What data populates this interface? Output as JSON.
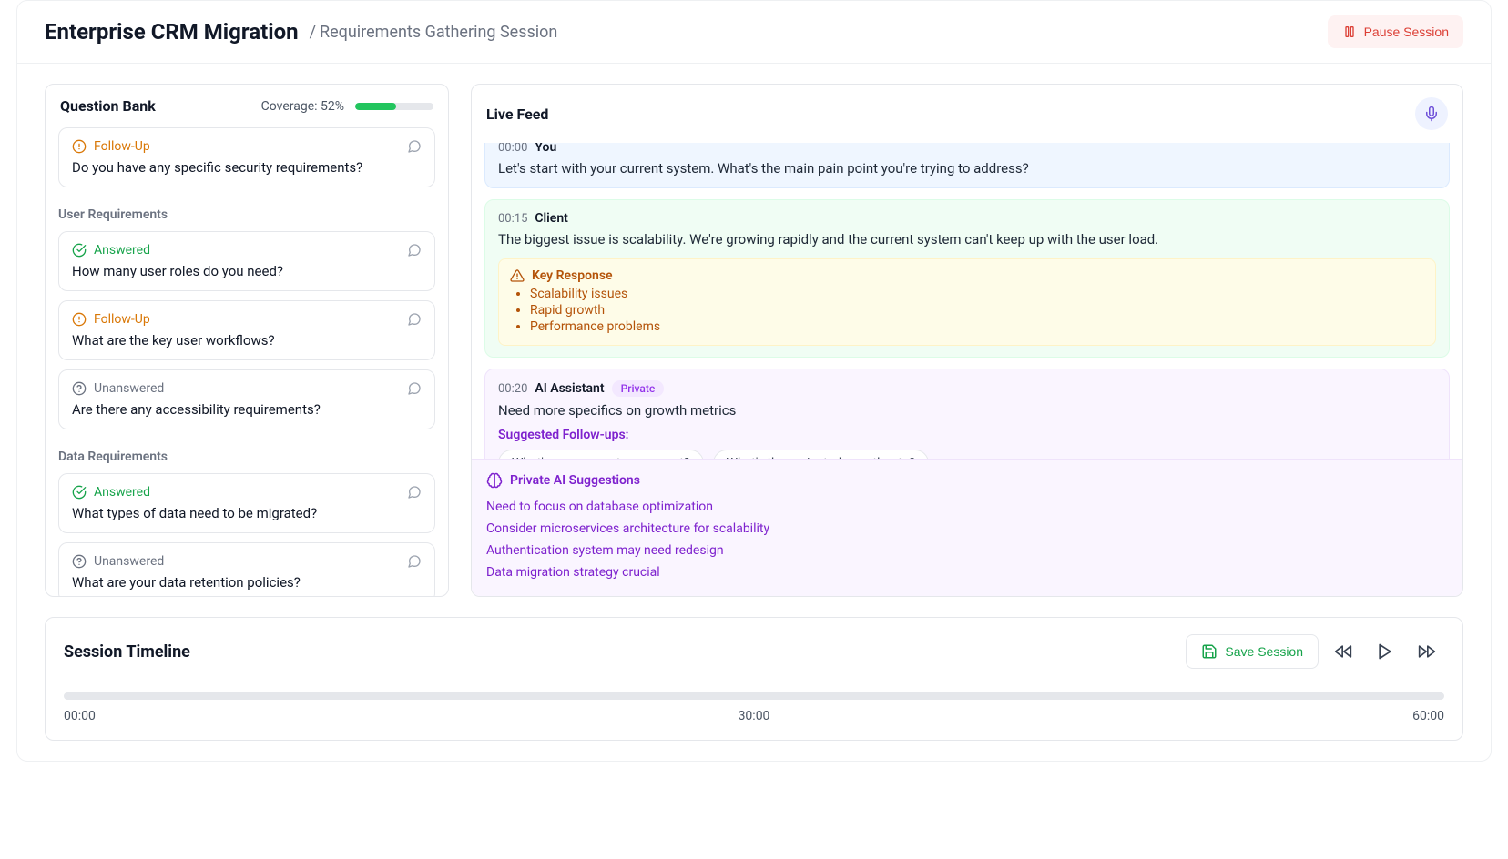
{
  "header": {
    "title": "Enterprise CRM Migration",
    "breadcrumb_sep": "/",
    "breadcrumb": "Requirements Gathering Session",
    "pause_label": "Pause Session"
  },
  "qbank": {
    "title": "Question Bank",
    "coverage_label": "Coverage: 52%",
    "coverage_pct": 52,
    "groups": [
      {
        "label_hidden": true,
        "label": "",
        "questions": [
          {
            "status": "followup",
            "status_label": "Follow-Up",
            "text": "Do you have any specific security requirements?"
          }
        ]
      },
      {
        "label": "User Requirements",
        "questions": [
          {
            "status": "answered",
            "status_label": "Answered",
            "text": "How many user roles do you need?"
          },
          {
            "status": "followup",
            "status_label": "Follow-Up",
            "text": "What are the key user workflows?"
          },
          {
            "status": "unanswered",
            "status_label": "Unanswered",
            "text": "Are there any accessibility requirements?"
          }
        ]
      },
      {
        "label": "Data Requirements",
        "questions": [
          {
            "status": "answered",
            "status_label": "Answered",
            "text": "What types of data need to be migrated?"
          },
          {
            "status": "unanswered",
            "status_label": "Unanswered",
            "text": "What are your data retention policies?"
          }
        ]
      }
    ]
  },
  "feed": {
    "title": "Live Feed",
    "items": [
      {
        "kind": "you",
        "time": "00:00",
        "speaker": "You",
        "text": "Let's start with your current system. What's the main pain point you're trying to address?"
      },
      {
        "kind": "client",
        "time": "00:15",
        "speaker": "Client",
        "text": "The biggest issue is scalability. We're growing rapidly and the current system can't keep up with the user load.",
        "key_response": {
          "title": "Key Response",
          "bullets": [
            "Scalability issues",
            "Rapid growth",
            "Performance problems"
          ]
        }
      },
      {
        "kind": "ai",
        "time": "00:20",
        "speaker": "AI Assistant",
        "private_label": "Private",
        "text": "Need more specifics on growth metrics",
        "suggested_label": "Suggested Follow-ups:",
        "suggestions": [
          "What's your current user count?",
          "What's the projected growth rate?"
        ]
      }
    ],
    "private_suggestions": {
      "title": "Private AI Suggestions",
      "items": [
        "Need to focus on database optimization",
        "Consider microservices architecture for scalability",
        "Authentication system may need redesign",
        "Data migration strategy crucial"
      ]
    }
  },
  "timeline": {
    "title": "Session Timeline",
    "save_label": "Save Session",
    "labels": [
      "00:00",
      "30:00",
      "60:00"
    ]
  }
}
